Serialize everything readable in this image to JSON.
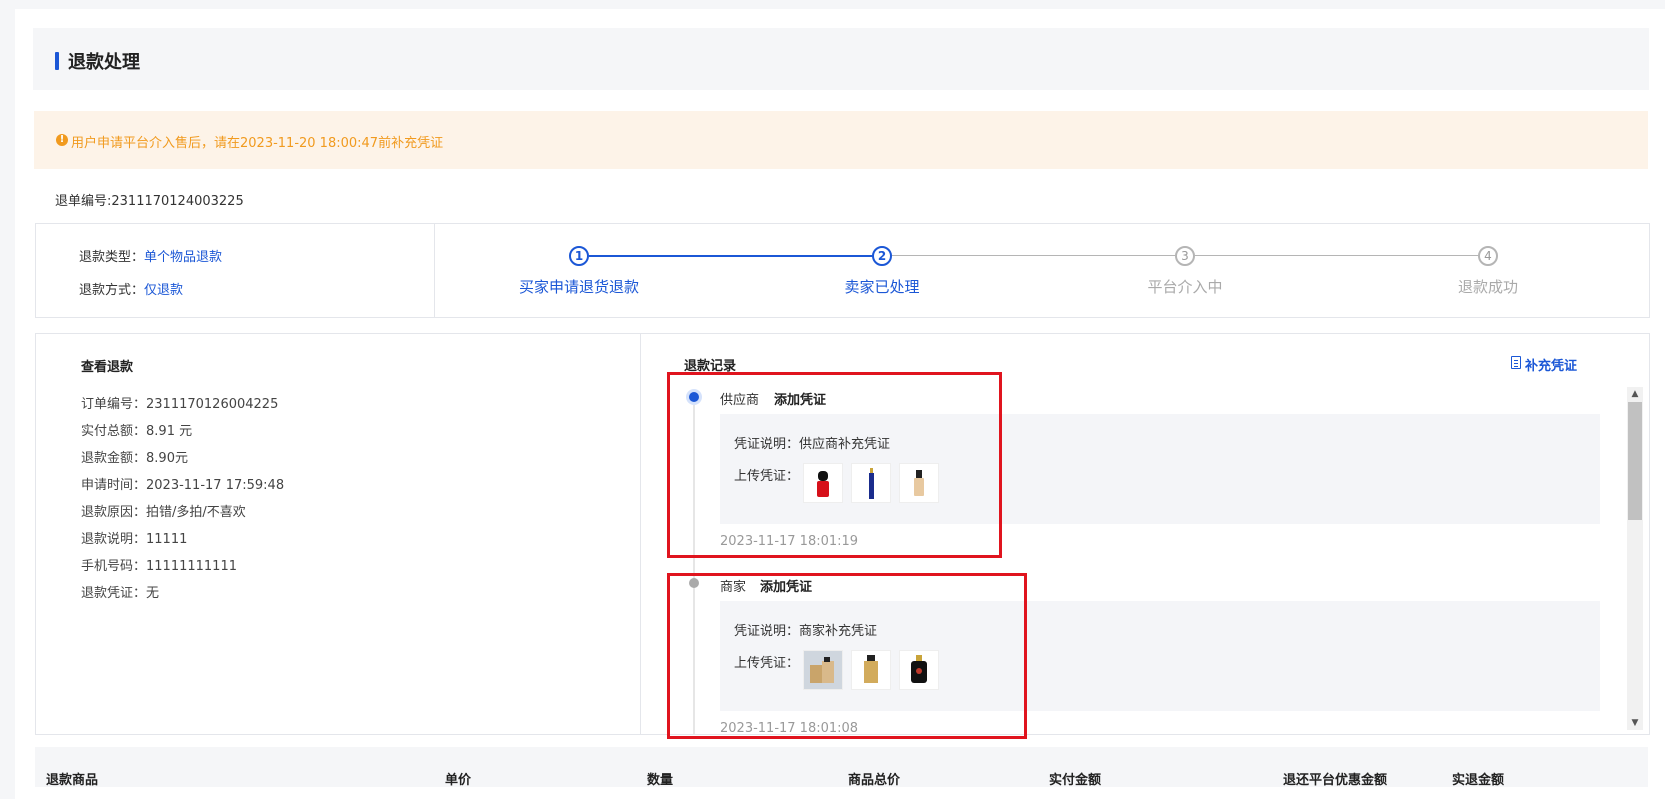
{
  "header": {
    "title": "退款处理"
  },
  "notice": {
    "icon": "info-icon",
    "text": "用户申请平台介入售后，请在2023-11-20 18:00:47前补充凭证"
  },
  "refund_no": "退单编号:2311170124003225",
  "refund_type": {
    "type_label": "退款类型：",
    "type_value": "单个物品退款",
    "method_label": "退款方式：",
    "method_value": "仅退款"
  },
  "steps": [
    {
      "num": "1",
      "label": "买家申请退货退款",
      "state": "done"
    },
    {
      "num": "2",
      "label": "卖家已处理",
      "state": "done"
    },
    {
      "num": "3",
      "label": "平台介入中",
      "state": "pending"
    },
    {
      "num": "4",
      "label": "退款成功",
      "state": "pending"
    }
  ],
  "detail": {
    "title": "查看退款",
    "rows": [
      {
        "label": "订单编号：",
        "value": "2311170126004225"
      },
      {
        "label": "实付总额：",
        "value": "8.91 元"
      },
      {
        "label": "退款金额：",
        "value": "8.90元"
      },
      {
        "label": "申请时间：",
        "value": "2023-11-17 17:59:48"
      },
      {
        "label": "退款原因：",
        "value": "拍错/多拍/不喜欢"
      },
      {
        "label": "退款说明：",
        "value": "11111"
      },
      {
        "label": "手机号码：",
        "value": "11111111111"
      },
      {
        "label": "退款凭证：",
        "value": "无"
      }
    ]
  },
  "records": {
    "title": "退款记录",
    "add_proof_label": "补充凭证",
    "items": [
      {
        "who": "供应商",
        "action": "添加凭证",
        "desc_label": "凭证说明：",
        "desc_value": "供应商补充凭证",
        "upload_label": "上传凭证：",
        "time": "2023-11-17 18:01:19",
        "thumbs": [
          "lipstick-image",
          "eyeliner-image",
          "foundation-image"
        ]
      },
      {
        "who": "商家",
        "action": "添加凭证",
        "desc_label": "凭证说明：",
        "desc_value": "商家补充凭证",
        "upload_label": "上传凭证：",
        "time": "2023-11-17 18:01:08",
        "thumbs": [
          "perfume-set-image",
          "gold-bottle-image",
          "black-perfume-image"
        ]
      }
    ]
  },
  "table": {
    "headers": [
      "退款商品",
      "单价",
      "数量",
      "商品总价",
      "实付金额",
      "退还平台优惠金额",
      "实退金额"
    ]
  },
  "colors": {
    "accent": "#1b57d6",
    "warning": "#f19a1e",
    "highlight_red": "#e0141e"
  }
}
